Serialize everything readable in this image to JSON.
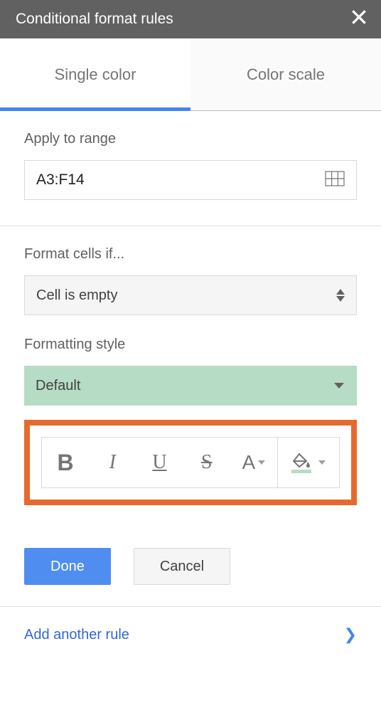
{
  "header": {
    "title": "Conditional format rules"
  },
  "tabs": {
    "single_color": "Single color",
    "color_scale": "Color scale"
  },
  "range": {
    "label": "Apply to range",
    "value": "A3:F14"
  },
  "condition": {
    "label": "Format cells if...",
    "selected": "Cell is empty"
  },
  "style": {
    "label": "Formatting style",
    "selected": "Default"
  },
  "toolbar": {
    "bold": "B",
    "italic": "I",
    "underline": "U",
    "strike": "S",
    "textcolor": "A"
  },
  "buttons": {
    "done": "Done",
    "cancel": "Cancel"
  },
  "footer": {
    "add_rule": "Add another rule"
  }
}
